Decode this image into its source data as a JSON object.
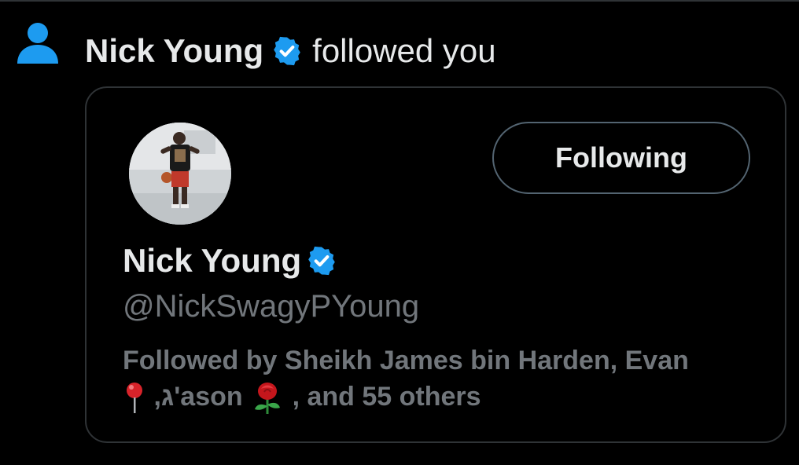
{
  "notification": {
    "actor_name": "Nick Young",
    "action": "followed you",
    "icon": "person-icon"
  },
  "card": {
    "display_name": "Nick Young",
    "handle": "@NickSwagyPYoung",
    "follow_button_label": "Following",
    "followed_by": {
      "prefix": "Followed by",
      "names": [
        "Sheikh James bin Harden",
        "Evan",
        "ג'ason"
      ],
      "suffix": ", and 55 others"
    }
  },
  "colors": {
    "background": "#000000",
    "text_primary": "#e7e9ea",
    "text_secondary": "#71767b",
    "accent_blue": "#1d9bf0",
    "border": "#2f3336"
  }
}
